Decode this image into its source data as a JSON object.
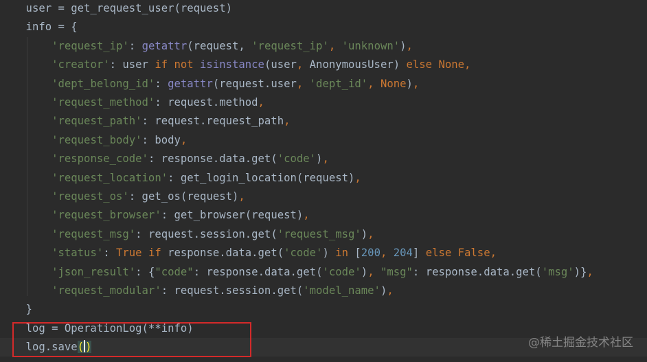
{
  "colors": {
    "background": "#2b2b2b",
    "current_line": "#323232",
    "keyword": "#cc7832",
    "string": "#6a8759",
    "number": "#6897bb",
    "builtin": "#8888c6",
    "text": "#a9b7c6",
    "highlight_box": "#d42a2a"
  },
  "code": {
    "lines": [
      [
        {
          "t": "t",
          "v": "    user = get_request_user(request)"
        }
      ],
      [
        {
          "t": "t",
          "v": "    info = {"
        }
      ],
      [
        {
          "t": "t",
          "v": "        "
        },
        {
          "t": "s",
          "v": "'request_ip'"
        },
        {
          "t": "t",
          "v": ": "
        },
        {
          "t": "b",
          "v": "getattr"
        },
        {
          "t": "t",
          "v": "(request, "
        },
        {
          "t": "s",
          "v": "'request_ip'"
        },
        {
          "t": "k",
          "v": ", "
        },
        {
          "t": "s",
          "v": "'unknown'"
        },
        {
          "t": "t",
          "v": ")"
        },
        {
          "t": "k",
          "v": ","
        }
      ],
      [
        {
          "t": "t",
          "v": "        "
        },
        {
          "t": "s",
          "v": "'creator'"
        },
        {
          "t": "t",
          "v": ": user "
        },
        {
          "t": "k",
          "v": "if not "
        },
        {
          "t": "b",
          "v": "isinstance"
        },
        {
          "t": "t",
          "v": "(user"
        },
        {
          "t": "k",
          "v": ", "
        },
        {
          "t": "t",
          "v": "AnonymousUser) "
        },
        {
          "t": "k",
          "v": "else None,"
        }
      ],
      [
        {
          "t": "t",
          "v": "        "
        },
        {
          "t": "s",
          "v": "'dept_belong_id'"
        },
        {
          "t": "t",
          "v": ": "
        },
        {
          "t": "b",
          "v": "getattr"
        },
        {
          "t": "t",
          "v": "(request.user"
        },
        {
          "t": "k",
          "v": ", "
        },
        {
          "t": "s",
          "v": "'dept_id'"
        },
        {
          "t": "k",
          "v": ", None"
        },
        {
          "t": "t",
          "v": ")"
        },
        {
          "t": "k",
          "v": ","
        }
      ],
      [
        {
          "t": "t",
          "v": "        "
        },
        {
          "t": "s",
          "v": "'request_method'"
        },
        {
          "t": "t",
          "v": ": request.method"
        },
        {
          "t": "k",
          "v": ","
        }
      ],
      [
        {
          "t": "t",
          "v": "        "
        },
        {
          "t": "s",
          "v": "'request_path'"
        },
        {
          "t": "t",
          "v": ": request.request_path"
        },
        {
          "t": "k",
          "v": ","
        }
      ],
      [
        {
          "t": "t",
          "v": "        "
        },
        {
          "t": "s",
          "v": "'request_body'"
        },
        {
          "t": "t",
          "v": ": body"
        },
        {
          "t": "k",
          "v": ","
        }
      ],
      [
        {
          "t": "t",
          "v": "        "
        },
        {
          "t": "s",
          "v": "'response_code'"
        },
        {
          "t": "t",
          "v": ": response.data.get("
        },
        {
          "t": "s",
          "v": "'code'"
        },
        {
          "t": "t",
          "v": ")"
        },
        {
          "t": "k",
          "v": ","
        }
      ],
      [
        {
          "t": "t",
          "v": "        "
        },
        {
          "t": "s",
          "v": "'request_location'"
        },
        {
          "t": "t",
          "v": ": get_login_location(request)"
        },
        {
          "t": "k",
          "v": ","
        }
      ],
      [
        {
          "t": "t",
          "v": "        "
        },
        {
          "t": "s",
          "v": "'request_os'"
        },
        {
          "t": "t",
          "v": ": get_os(request)"
        },
        {
          "t": "k",
          "v": ","
        }
      ],
      [
        {
          "t": "t",
          "v": "        "
        },
        {
          "t": "s",
          "v": "'request_browser'"
        },
        {
          "t": "t",
          "v": ": get_browser(request)"
        },
        {
          "t": "k",
          "v": ","
        }
      ],
      [
        {
          "t": "t",
          "v": "        "
        },
        {
          "t": "s",
          "v": "'request_msg'"
        },
        {
          "t": "t",
          "v": ": request.session.get("
        },
        {
          "t": "s",
          "v": "'request_msg'"
        },
        {
          "t": "t",
          "v": ")"
        },
        {
          "t": "k",
          "v": ","
        }
      ],
      [
        {
          "t": "t",
          "v": "        "
        },
        {
          "t": "s",
          "v": "'status'"
        },
        {
          "t": "t",
          "v": ": "
        },
        {
          "t": "k",
          "v": "True if "
        },
        {
          "t": "t",
          "v": "response.data.get("
        },
        {
          "t": "s",
          "v": "'code'"
        },
        {
          "t": "t",
          "v": ") "
        },
        {
          "t": "k",
          "v": "in "
        },
        {
          "t": "t",
          "v": "["
        },
        {
          "t": "n",
          "v": "200"
        },
        {
          "t": "k",
          "v": ", "
        },
        {
          "t": "n",
          "v": "204"
        },
        {
          "t": "t",
          "v": "] "
        },
        {
          "t": "k",
          "v": "else False,"
        }
      ],
      [
        {
          "t": "t",
          "v": "        "
        },
        {
          "t": "s",
          "v": "'json_result'"
        },
        {
          "t": "t",
          "v": ": {"
        },
        {
          "t": "s",
          "v": "\"code\""
        },
        {
          "t": "t",
          "v": ": response.data.get("
        },
        {
          "t": "s",
          "v": "'code'"
        },
        {
          "t": "t",
          "v": ")"
        },
        {
          "t": "k",
          "v": ", "
        },
        {
          "t": "s",
          "v": "\"msg\""
        },
        {
          "t": "t",
          "v": ": response.data.get("
        },
        {
          "t": "s",
          "v": "'msg'"
        },
        {
          "t": "t",
          "v": ")}"
        },
        {
          "t": "k",
          "v": ","
        }
      ],
      [
        {
          "t": "t",
          "v": "        "
        },
        {
          "t": "s",
          "v": "'request_modular'"
        },
        {
          "t": "t",
          "v": ": request.session.get("
        },
        {
          "t": "s",
          "v": "'model_name'"
        },
        {
          "t": "t",
          "v": ")"
        },
        {
          "t": "k",
          "v": ","
        }
      ],
      [
        {
          "t": "t",
          "v": "    }"
        }
      ],
      [
        {
          "t": "t",
          "v": "    log = OperationLog(**info)"
        }
      ],
      [
        {
          "t": "t",
          "v": "    log.save"
        },
        {
          "t": "m",
          "v": "("
        },
        {
          "t": "c",
          "v": ""
        },
        {
          "t": "m",
          "v": ")"
        }
      ]
    ],
    "current_line_index": 18
  },
  "watermark": "@稀土掘金技术社区"
}
